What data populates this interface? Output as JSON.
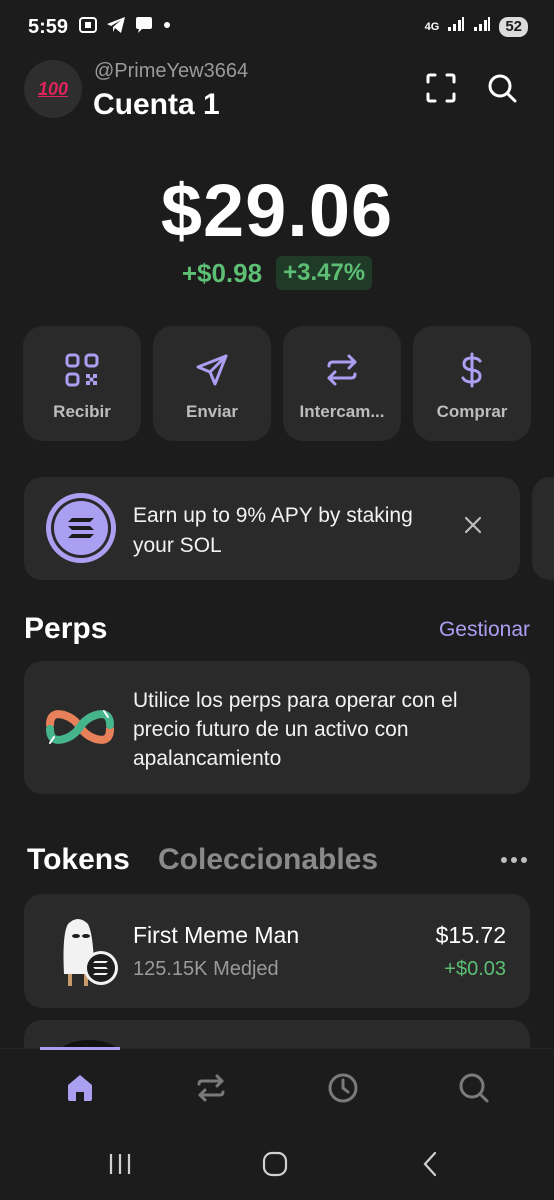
{
  "status_bar": {
    "time": "5:59",
    "network": "4G",
    "battery": "52",
    "icons": [
      "screenshot-icon",
      "telegram-icon",
      "chat-bubble-icon",
      "dot-icon",
      "signal-icon",
      "signal-icon",
      "battery-icon"
    ]
  },
  "header": {
    "avatar_emoji": "100",
    "username": "@PrimeYew3664",
    "account_name": "Cuenta 1",
    "icons": [
      "scan-icon",
      "search-icon"
    ]
  },
  "balance": {
    "total": "$29.06",
    "change_abs": "+$0.98",
    "change_pct": "+3.47%"
  },
  "actions": [
    {
      "label": "Recibir",
      "icon": "qr-code-icon"
    },
    {
      "label": "Enviar",
      "icon": "send-icon"
    },
    {
      "label": "Intercam...",
      "icon": "swap-icon"
    },
    {
      "label": "Comprar",
      "icon": "dollar-icon"
    }
  ],
  "promo": {
    "text": "Earn up to 9% APY by staking your SOL",
    "icon": "solana-icon"
  },
  "perps": {
    "title": "Perps",
    "manage_label": "Gestionar",
    "description": "Utilice los perps para operar con el precio futuro de un activo con apalancamiento"
  },
  "tabs": {
    "tokens": "Tokens",
    "collectibles": "Coleccionables"
  },
  "tokens": [
    {
      "name": "First Meme Man",
      "amount": "125.15K Medjed",
      "value": "$15.72",
      "change": "+$0.03"
    }
  ],
  "bottom_nav": [
    "home-icon",
    "swap-icon",
    "history-icon",
    "search-icon"
  ],
  "colors": {
    "background": "#1c1c1c",
    "card": "#2a2a2a",
    "accent": "#ab9ff2",
    "positive": "#5cbf73"
  }
}
